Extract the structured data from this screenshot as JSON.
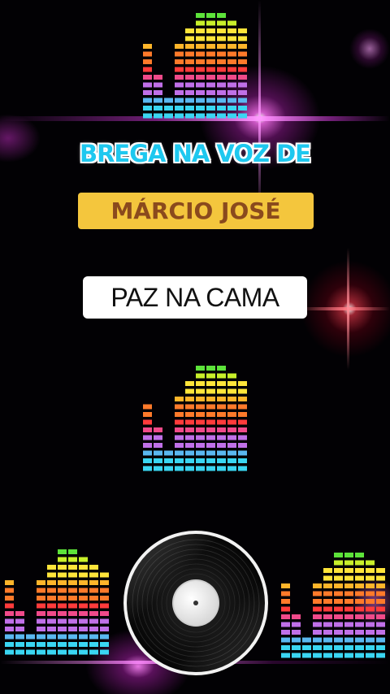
{
  "overlay": {
    "headline": "BREGA NA VOZ DE",
    "artist": "MÁRCIO JOSÉ",
    "song": "PAZ NA CAMA"
  },
  "equalizer": {
    "palette": [
      "#3ad6f2",
      "#5ab8f0",
      "#c070e8",
      "#f04a8a",
      "#ff3b3b",
      "#ff7a2a",
      "#ffb52a",
      "#ffe53a",
      "#c8f02a",
      "#5de33a"
    ],
    "top_levels": [
      10,
      6,
      3,
      10,
      12,
      14,
      14,
      14,
      13,
      12
    ],
    "middle_levels": [
      9,
      6,
      3,
      10,
      12,
      14,
      14,
      14,
      13,
      12
    ],
    "bottom_left_levels": [
      10,
      6,
      3,
      10,
      12,
      14,
      14,
      13,
      12,
      11
    ],
    "bottom_right_levels": [
      10,
      6,
      3,
      10,
      12,
      14,
      14,
      14,
      13,
      12
    ]
  },
  "colors": {
    "background": "#020104",
    "headline": "#1ec8ef",
    "artist_box": "#f4c63d",
    "artist_text": "#8a4a1d",
    "song_box": "#ffffff",
    "flare_pink": "#ff3cf0",
    "flare_red": "#ff2a3a"
  }
}
